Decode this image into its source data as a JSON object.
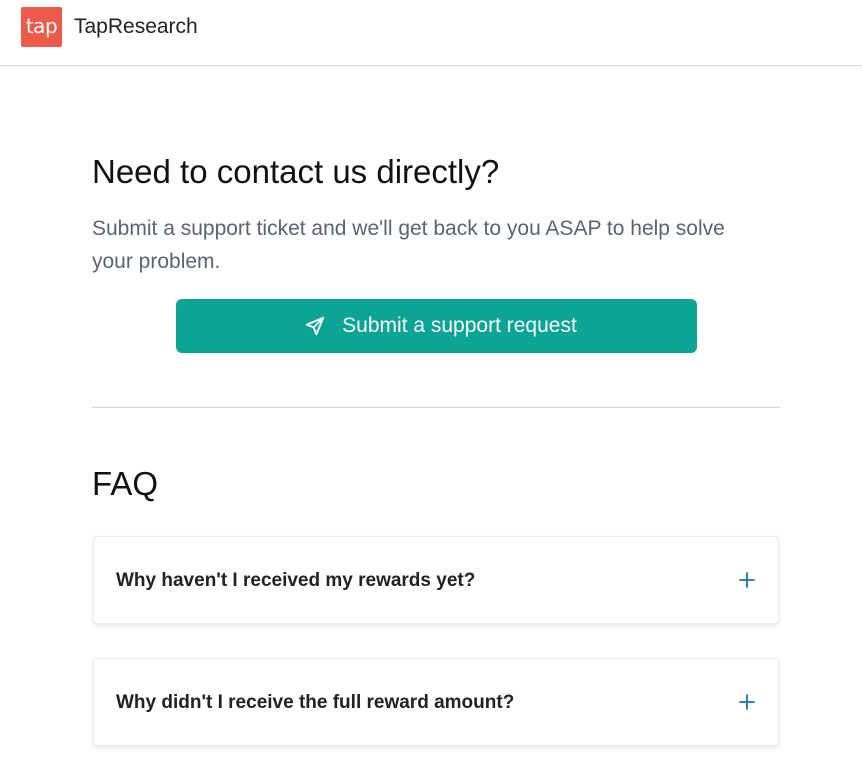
{
  "header": {
    "logo_text": "tap",
    "brand_name": "TapResearch",
    "logo_color": "#ee5a4a"
  },
  "contact": {
    "title": "Need to contact us directly?",
    "description": "Submit a support ticket and we'll get back to you ASAP to help solve your problem.",
    "button_label": "Submit a support request",
    "button_icon": "send-icon",
    "button_color": "#0ca595"
  },
  "faq": {
    "title": "FAQ",
    "items": [
      {
        "question": "Why haven't I received my rewards yet?",
        "icon": "plus-icon"
      },
      {
        "question": "Why didn't I receive the full reward amount?",
        "icon": "plus-icon"
      }
    ],
    "accent_color": "#1a6fb3"
  }
}
